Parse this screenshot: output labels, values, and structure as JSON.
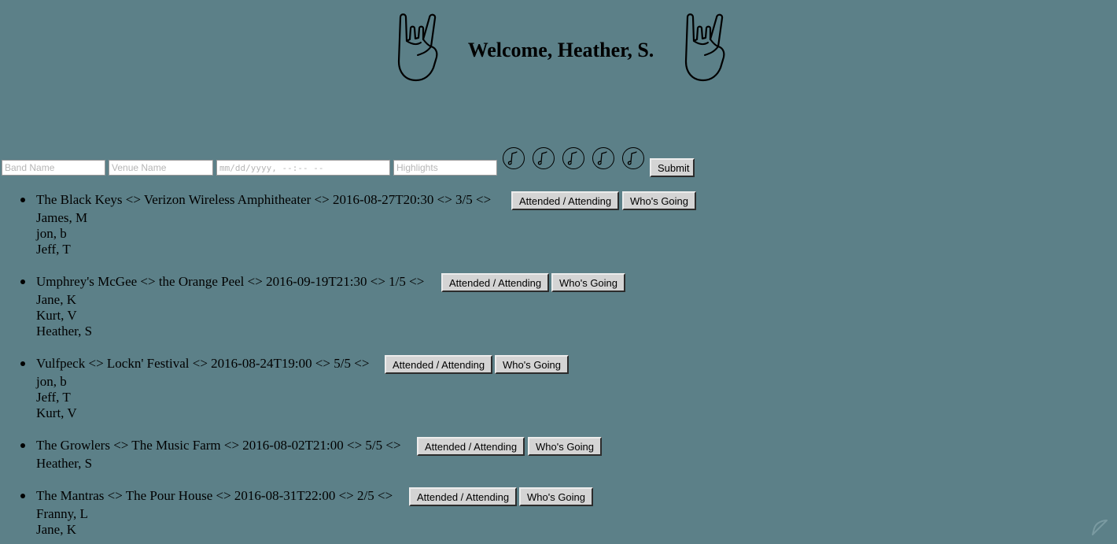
{
  "header": {
    "welcome": "Welcome, Heather, S.",
    "left_icon": "rock-hand-icon",
    "right_icon": "rock-hand-icon"
  },
  "form": {
    "band_placeholder": "Band Name",
    "venue_placeholder": "Venue Name",
    "date_placeholder": "mm/dd/yyyy, --:-- --",
    "highlights_placeholder": "Highlights",
    "rating_icons": [
      "music-note-icon",
      "music-note-icon",
      "music-note-icon",
      "music-note-icon",
      "music-note-icon"
    ],
    "submit_label": "Submit"
  },
  "buttons": {
    "attended_label": "Attended / Attending",
    "whos_going_label": "Who's Going"
  },
  "concerts": [
    {
      "summary": "The Black Keys <> Verizon Wireless Amphitheater <> 2016-08-27T20:30 <> 3/5 <>",
      "attendees": [
        "James, M",
        "jon, b",
        "Jeff, T"
      ]
    },
    {
      "summary": "Umphrey's McGee <> the Orange Peel <> 2016-09-19T21:30 <> 1/5 <>",
      "attendees": [
        "Jane, K",
        "Kurt, V",
        "Heather, S"
      ]
    },
    {
      "summary": "Vulfpeck <> Lockn' Festival <> 2016-08-24T19:00 <> 5/5 <>",
      "attendees": [
        "jon, b",
        "Jeff, T",
        "Kurt, V"
      ]
    },
    {
      "summary": "The Growlers <> The Music Farm <> 2016-08-02T21:00 <> 5/5 <>",
      "attendees": [
        "Heather, S"
      ]
    },
    {
      "summary": "The Mantras <> The Pour House <> 2016-08-31T22:00 <> 2/5 <>",
      "attendees": [
        "Franny, L",
        "Jane, K"
      ]
    }
  ],
  "colors": {
    "background": "#5c8088",
    "button": "#d4d4d4"
  }
}
